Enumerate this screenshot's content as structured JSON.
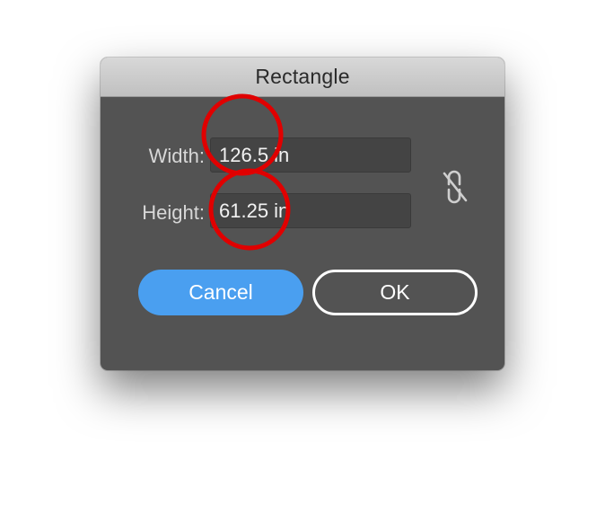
{
  "dialog": {
    "title": "Rectangle",
    "width_label": "Width:",
    "width_value": "126.5 in",
    "height_label": "Height:",
    "height_value": "61.25 in",
    "constrain_icon": "unlinked-chain-icon",
    "cancel_label": "Cancel",
    "ok_label": "OK"
  },
  "annotations": {
    "color": "#e00000",
    "marks": [
      "width-digit-circle",
      "height-digit-circle"
    ]
  },
  "colors": {
    "dialog_bg": "#535353",
    "field_bg": "#444444",
    "accent": "#4a9ff0"
  }
}
